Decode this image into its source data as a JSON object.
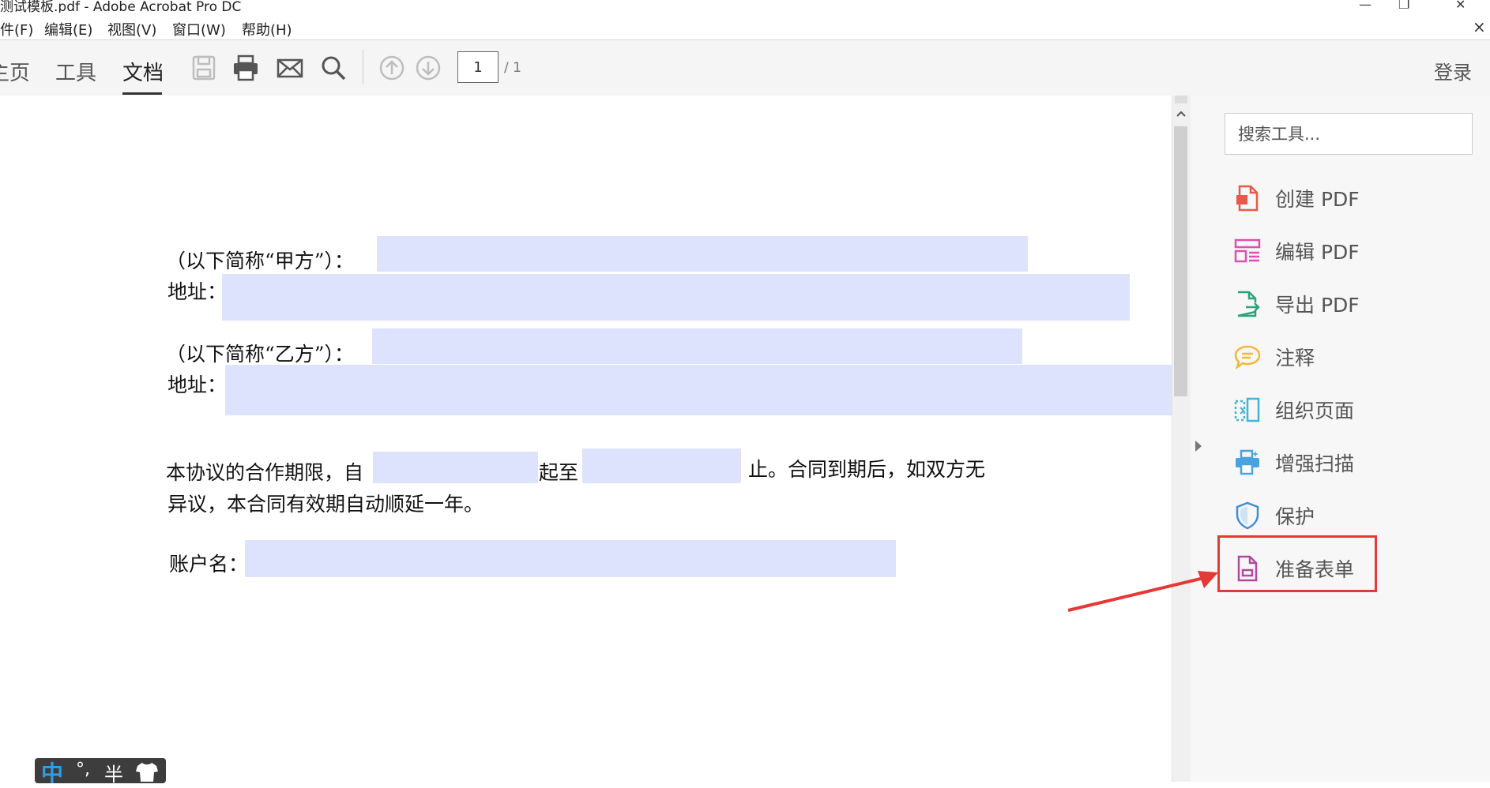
{
  "window": {
    "title": "测试模板.pdf - Adobe Acrobat Pro DC",
    "minimize_glyph": "—",
    "maximize_glyph": "❐",
    "close_glyph": "✕",
    "doc_close_glyph": "×"
  },
  "menu": [
    "件(F)",
    "编辑(E)",
    "视图(V)",
    "窗口(W)",
    "帮助(H)"
  ],
  "tabs": {
    "home": "主页",
    "tools": "工具",
    "document": "文档"
  },
  "nav": {
    "current_page": "1",
    "total_pages": "/ 1"
  },
  "login_label": "登录",
  "document": {
    "lines": {
      "party_a": "（以下简称“甲方”）：",
      "address_a": "地址：",
      "party_b": "（以下简称“乙方”）：",
      "address_b": "地址：",
      "period_start": "本协议的合作期限，自",
      "period_mid": "起至",
      "period_end": "止。合同到期后，如双方无",
      "period_line2": "异议，本合同有效期自动顺延一年。",
      "account_name": "账户名："
    }
  },
  "right_panel": {
    "search_placeholder": "搜索工具...",
    "tools": [
      {
        "label": "创建 PDF",
        "icon": "create-pdf-icon",
        "color": "#e8594a"
      },
      {
        "label": "编辑 PDF",
        "icon": "edit-pdf-icon",
        "color": "#e04fb1"
      },
      {
        "label": "导出 PDF",
        "icon": "export-pdf-icon",
        "color": "#2aa37a"
      },
      {
        "label": "注释",
        "icon": "comment-icon",
        "color": "#f2b836"
      },
      {
        "label": "组织页面",
        "icon": "organize-pages-icon",
        "color": "#43b4d6"
      },
      {
        "label": "增强扫描",
        "icon": "enhance-scan-icon",
        "color": "#4aa3e0"
      },
      {
        "label": "保护",
        "icon": "protect-icon",
        "color": "#3e8fd8"
      },
      {
        "label": "准备表单",
        "icon": "prepare-form-icon",
        "color": "#b04a9e"
      }
    ]
  },
  "annotation": {
    "highlight_color": "#e53935"
  },
  "ime": {
    "mode": "中",
    "punct": "°,",
    "width": "半"
  }
}
